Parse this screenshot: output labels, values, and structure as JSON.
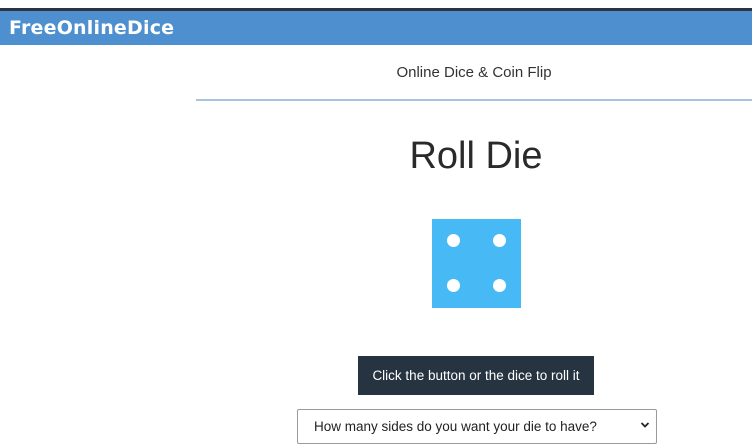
{
  "header": {
    "brand": "FreeOnlineDice"
  },
  "nav": {
    "subtitle": "Online Dice & Coin Flip"
  },
  "main": {
    "title": "Roll Die",
    "die": {
      "face_value": 4,
      "color": "#47baf5"
    },
    "roll_button_label": "Click the button or the dice to roll it",
    "sides_select": {
      "selected_label": "How many sides do you want your die to have?"
    }
  },
  "colors": {
    "header_bg": "#4e8fcf",
    "button_bg": "#263340",
    "divider": "#a8c3de"
  }
}
